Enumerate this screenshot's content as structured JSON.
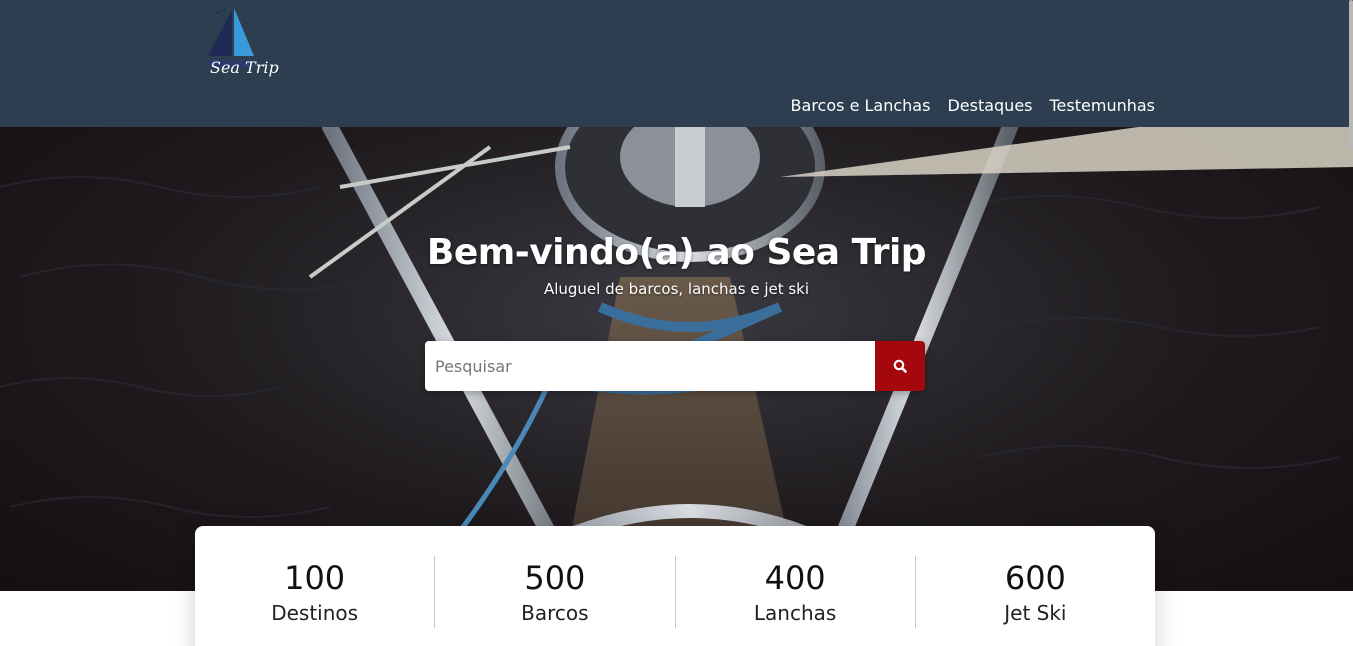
{
  "brand": {
    "name": "Sea Trip",
    "logo_icon": "sailboat-icon",
    "colors": {
      "navbar": "#2c3e50",
      "accent": "#a4070e"
    }
  },
  "nav": {
    "items": [
      {
        "label": "Barcos e Lanchas"
      },
      {
        "label": "Destaques"
      },
      {
        "label": "Testemunhas"
      }
    ]
  },
  "hero": {
    "title": "Bem-vindo(a) ao Sea Trip",
    "subtitle": "Aluguel de barcos, lanchas e jet ski",
    "background": "boat-deck-photo"
  },
  "search": {
    "placeholder": "Pesquisar",
    "value": "",
    "button_icon": "search-icon"
  },
  "stats": [
    {
      "number": "100",
      "label": "Destinos"
    },
    {
      "number": "500",
      "label": "Barcos"
    },
    {
      "number": "400",
      "label": "Lanchas"
    },
    {
      "number": "600",
      "label": "Jet Ski"
    }
  ]
}
